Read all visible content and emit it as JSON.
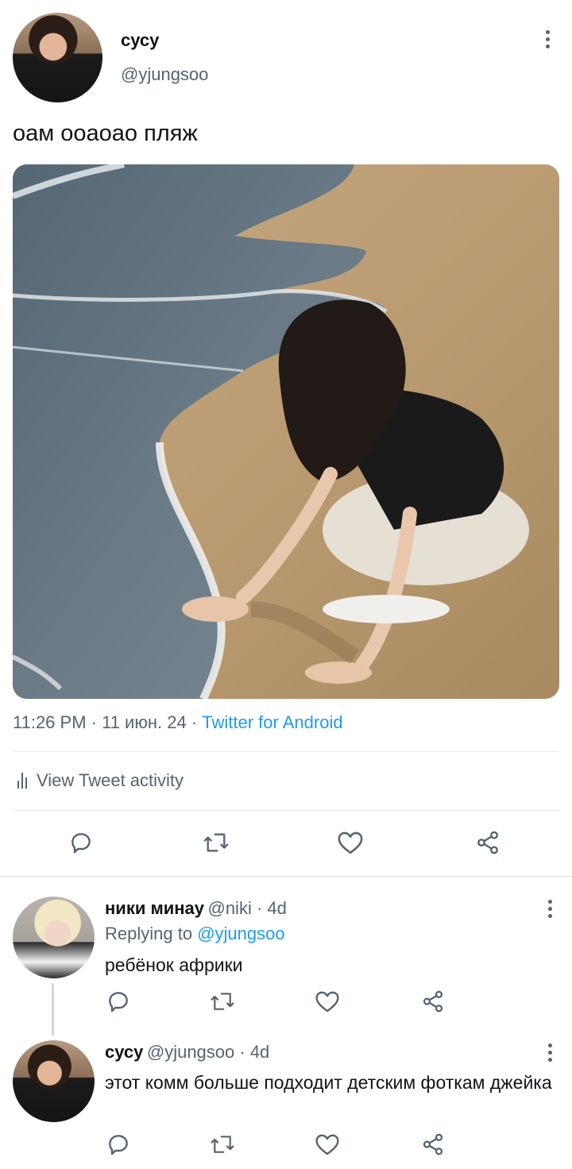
{
  "main_tweet": {
    "display_name": "сусу",
    "handle": "@yjungsoo",
    "text": "оам ооаоао пляж",
    "time": "11:26 PM",
    "sep1": " · ",
    "date": "11 июн. 24",
    "sep2": " · ",
    "client": "Twitter for Android",
    "activity_label": "View Tweet activity"
  },
  "replies": [
    {
      "display_name": "ники минау",
      "handle": "@niki",
      "age": " · 4d",
      "replying_prefix": "Replying to ",
      "replying_to": "@yjungsoo",
      "text": "ребёнок африки"
    },
    {
      "display_name": "сусу",
      "handle": "@yjungsoo",
      "age": " · 4d",
      "text": "этот комм больше подходит детским фоткам джейка"
    }
  ],
  "icons": {
    "more": "more-vertical-icon",
    "reply": "reply-icon",
    "retweet": "retweet-icon",
    "like": "heart-icon",
    "share": "share-icon",
    "activity": "bar-chart-icon"
  },
  "colors": {
    "link": "#1d9bf0",
    "secondary_text": "#536471",
    "primary_text": "#0f1419"
  }
}
